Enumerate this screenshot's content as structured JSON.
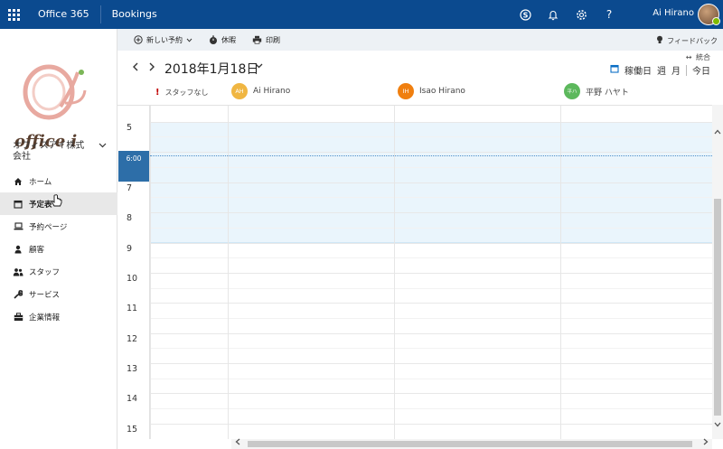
{
  "topbar": {
    "suite_name": "Office 365",
    "app_name": "Bookings",
    "user_name": "Ai Hirano",
    "icons": [
      "skype-icon",
      "bell-icon",
      "gear-icon",
      "help-icon"
    ],
    "help_label": "?"
  },
  "sidebar": {
    "logo_text": "office i",
    "company_name": "オフィスアイ株式会社",
    "items": [
      {
        "label": "ホーム",
        "icon": "home-icon"
      },
      {
        "label": "予定表",
        "icon": "calendar-icon",
        "active": true
      },
      {
        "label": "予約ページ",
        "icon": "laptop-icon"
      },
      {
        "label": "顧客",
        "icon": "person-icon"
      },
      {
        "label": "スタッフ",
        "icon": "people-icon"
      },
      {
        "label": "サービス",
        "icon": "wrench-icon"
      },
      {
        "label": "企業情報",
        "icon": "briefcase-icon"
      }
    ]
  },
  "commandbar": {
    "new_booking": "新しい予約",
    "time_off": "休暇",
    "print": "印刷",
    "feedback": "フィードバック"
  },
  "calendar": {
    "date_title": "2018年1月18日",
    "merge_label": "統合",
    "views": {
      "day": "稼働日",
      "week": "週",
      "month": "月",
      "today": "今日"
    },
    "no_staff": "スタッフなし",
    "staff": [
      {
        "initials": "AH",
        "name": "Ai Hirano",
        "color": "#f0b642"
      },
      {
        "initials": "IH",
        "name": "Isao Hirano",
        "color": "#f07f0f"
      },
      {
        "initials": "平ハ",
        "name": "平野 ハヤト",
        "color": "#5cb85c"
      }
    ],
    "hours": [
      "5",
      "7",
      "8",
      "9",
      "10",
      "11",
      "12",
      "13",
      "14",
      "15"
    ],
    "current_time": "6:00"
  },
  "colors": {
    "topbar": "#0b4a8f",
    "accent": "#0b6ec5",
    "working_hours": "#eaf5fc",
    "now_marker": "#2d6ea8"
  }
}
